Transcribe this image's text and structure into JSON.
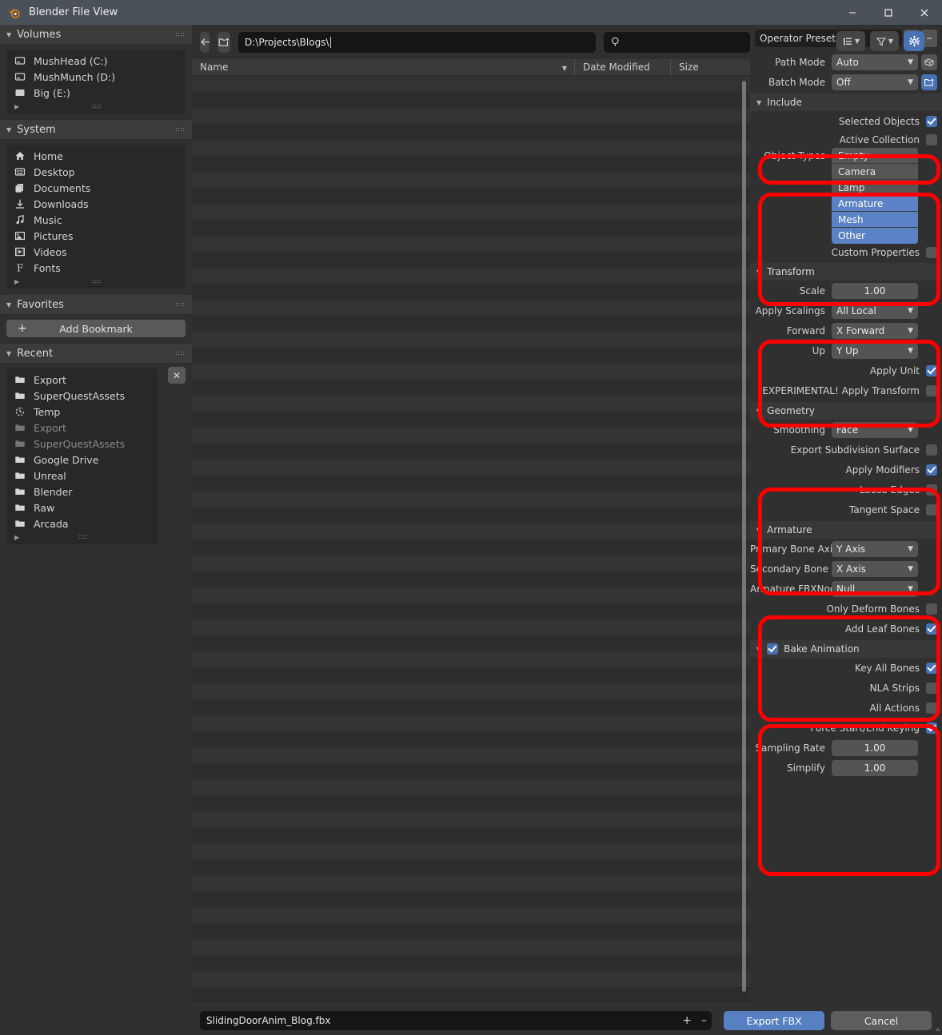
{
  "window": {
    "title": "Blender File View",
    "minimize_label": "–",
    "maximize_label": "❑",
    "close_label": "✕"
  },
  "sidebar": {
    "volumes": {
      "title": "Volumes",
      "items": [
        {
          "label": "MushHead (C:)",
          "icon": "disk-drive-icon"
        },
        {
          "label": "MushMunch (D:)",
          "icon": "disk-drive-icon"
        },
        {
          "label": "Big (E:)",
          "icon": "disk-drive-icon"
        }
      ]
    },
    "system": {
      "title": "System",
      "items": [
        {
          "label": "Home",
          "icon": "home-icon"
        },
        {
          "label": "Desktop",
          "icon": "desktop-icon"
        },
        {
          "label": "Documents",
          "icon": "documents-icon"
        },
        {
          "label": "Downloads",
          "icon": "download-icon"
        },
        {
          "label": "Music",
          "icon": "music-note-icon"
        },
        {
          "label": "Pictures",
          "icon": "picture-icon"
        },
        {
          "label": "Videos",
          "icon": "film-icon"
        },
        {
          "label": "Fonts",
          "icon": "font-icon"
        }
      ]
    },
    "favorites": {
      "title": "Favorites",
      "add_bookmark_label": "Add Bookmark",
      "add_bookmark_plus": "+"
    },
    "recent": {
      "title": "Recent",
      "clear_label": "✕",
      "items": [
        {
          "label": "Export",
          "icon": "folder-icon",
          "dim": false
        },
        {
          "label": "SuperQuestAssets",
          "icon": "folder-icon",
          "dim": false
        },
        {
          "label": "Temp",
          "icon": "recent-clock-icon",
          "dim": false
        },
        {
          "label": "Export",
          "icon": "folder-icon",
          "dim": true
        },
        {
          "label": "SuperQuestAssets",
          "icon": "folder-icon",
          "dim": true
        },
        {
          "label": "Google Drive",
          "icon": "folder-icon",
          "dim": false
        },
        {
          "label": "Unreal",
          "icon": "folder-icon",
          "dim": false
        },
        {
          "label": "Blender",
          "icon": "folder-icon",
          "dim": false
        },
        {
          "label": "Raw",
          "icon": "folder-icon",
          "dim": false
        },
        {
          "label": "Arcada",
          "icon": "folder-icon",
          "dim": false
        }
      ]
    }
  },
  "toolbar": {
    "back_icon": "arrow-left-icon",
    "forward_icon": "arrow-right-icon",
    "up_icon": "arrow-up-parent-icon",
    "refresh_icon": "refresh-icon",
    "new_folder_icon": "new-folder-icon",
    "path_value": "D:\\Projects\\Blogs\\",
    "search_placeholder": "",
    "search_icon": "search-icon",
    "display_mode_icon": "display-mode-icon",
    "filter_icon": "filter-funnel-icon",
    "options_icon": "gear-icon"
  },
  "filelist": {
    "columns": [
      "Name",
      "Date Modified",
      "Size"
    ],
    "sort_indicator": "▼",
    "rows": []
  },
  "footer": {
    "filename": "SlidingDoorAnim_Blog.fbx",
    "plus_label": "+",
    "minus_label": "–",
    "export_label": "Export FBX",
    "cancel_label": "Cancel"
  },
  "options": {
    "preset": {
      "label": "Operator Presets",
      "add_label": "+",
      "remove_label": "–"
    },
    "path_mode": {
      "label": "Path Mode",
      "value": "Auto",
      "icon": "box-icon"
    },
    "batch_mode": {
      "label": "Batch Mode",
      "value": "Off",
      "icon": "new-folder-icon"
    },
    "include": {
      "title": "Include",
      "selected_objects": {
        "label": "Selected Objects",
        "checked": true
      },
      "active_collection": {
        "label": "Active Collection",
        "checked": false
      },
      "object_types_label": "Object Types",
      "object_types": [
        {
          "label": "Empty",
          "selected": false
        },
        {
          "label": "Camera",
          "selected": false
        },
        {
          "label": "Lamp",
          "selected": false
        },
        {
          "label": "Armature",
          "selected": true
        },
        {
          "label": "Mesh",
          "selected": true
        },
        {
          "label": "Other",
          "selected": true
        }
      ],
      "custom_properties": {
        "label": "Custom Properties",
        "checked": false
      }
    },
    "transform": {
      "title": "Transform",
      "scale": {
        "label": "Scale",
        "value": "1.00"
      },
      "apply_scalings": {
        "label": "Apply Scalings",
        "value": "All Local"
      },
      "forward": {
        "label": "Forward",
        "value": "X Forward"
      },
      "up": {
        "label": "Up",
        "value": "Y Up"
      },
      "apply_unit": {
        "label": "Apply Unit",
        "checked": true
      },
      "apply_transform": {
        "label": "!EXPERIMENTAL! Apply Transform",
        "checked": false
      }
    },
    "geometry": {
      "title": "Geometry",
      "smoothing": {
        "label": "Smoothing",
        "value": "Face"
      },
      "export_subdivision_surface": {
        "label": "Export Subdivision Surface",
        "checked": false
      },
      "apply_modifiers": {
        "label": "Apply Modifiers",
        "checked": true
      },
      "loose_edges": {
        "label": "Loose Edges",
        "checked": false
      },
      "tangent_space": {
        "label": "Tangent Space",
        "checked": false
      }
    },
    "armature": {
      "title": "Armature",
      "primary_bone_axis": {
        "label": "Primary Bone Axis",
        "value": "Y Axis"
      },
      "secondary_bone_axis": {
        "label": "Secondary Bone Axi",
        "value": "X Axis"
      },
      "armature_fbxnode_type": {
        "label": "Armature FBXNode...",
        "value": "Null"
      },
      "only_deform_bones": {
        "label": "Only Deform Bones",
        "checked": false
      },
      "add_leaf_bones": {
        "label": "Add Leaf Bones",
        "checked": true
      }
    },
    "bake_animation": {
      "title": "Bake Animation",
      "enabled": true,
      "key_all_bones": {
        "label": "Key All Bones",
        "checked": true
      },
      "nla_strips": {
        "label": "NLA Strips",
        "checked": false
      },
      "all_actions": {
        "label": "All Actions",
        "checked": false
      },
      "force_start_end_keying": {
        "label": "Force Start/End Keying",
        "checked": true
      },
      "sampling_rate": {
        "label": "Sampling Rate",
        "value": "1.00"
      },
      "simplify": {
        "label": "Simplify",
        "value": "1.00"
      }
    }
  },
  "colors": {
    "accent_blue": "#4772b3",
    "selection_blue": "#5a82c4",
    "highlight_red": "#fe0000",
    "titlebar": "#4a5159",
    "panel_bg": "#303030"
  }
}
